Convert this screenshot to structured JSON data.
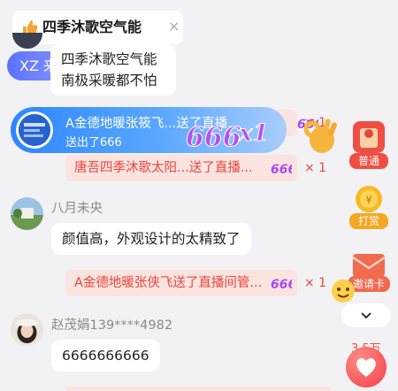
{
  "top_card": {
    "title": "四季沐歌空气能",
    "close": "×"
  },
  "entrance": {
    "text": "XZ 来了"
  },
  "ad_bubble": {
    "line1": "四季沐歌空气能",
    "line2": "南极采暖都不怕"
  },
  "fly_banner": {
    "line1": "A金德地暖张筱飞...送了直播...",
    "line2": "送出了666",
    "combo": "666",
    "multiplier": "x1"
  },
  "messages": [
    {
      "type": "gift",
      "text": "唐吾四季沐歌太阳...送了直播...",
      "count": "× 1"
    },
    {
      "type": "chat",
      "user": "八月未央",
      "text": "颜值高，外观设计的太精致了"
    },
    {
      "type": "gift",
      "text": "A金德地暖张侠飞送了直播间管...",
      "count": "× 1"
    },
    {
      "type": "chat",
      "user": "赵茂娟139****4982",
      "text": "6666666666"
    }
  ],
  "fly_count": "× 1",
  "gift_icon_text": "666",
  "side": {
    "putong": "普通",
    "dashang": "打赏",
    "yaoqingka": "邀请卡",
    "like_count": "3.5万"
  },
  "colors": {
    "gift_text": "#e9473b",
    "gift_bg": "#fbe3e0",
    "entrance_bg": "#6f83ff",
    "banner_bg": "#3b8cff"
  },
  "icons": [
    "thumbs-up-icon",
    "close-icon",
    "gift-666-icon",
    "red-envelope-icon",
    "coin-reward-icon",
    "invite-card-icon",
    "chevron-down-icon",
    "heart-icon",
    "ok-hand-icon"
  ]
}
